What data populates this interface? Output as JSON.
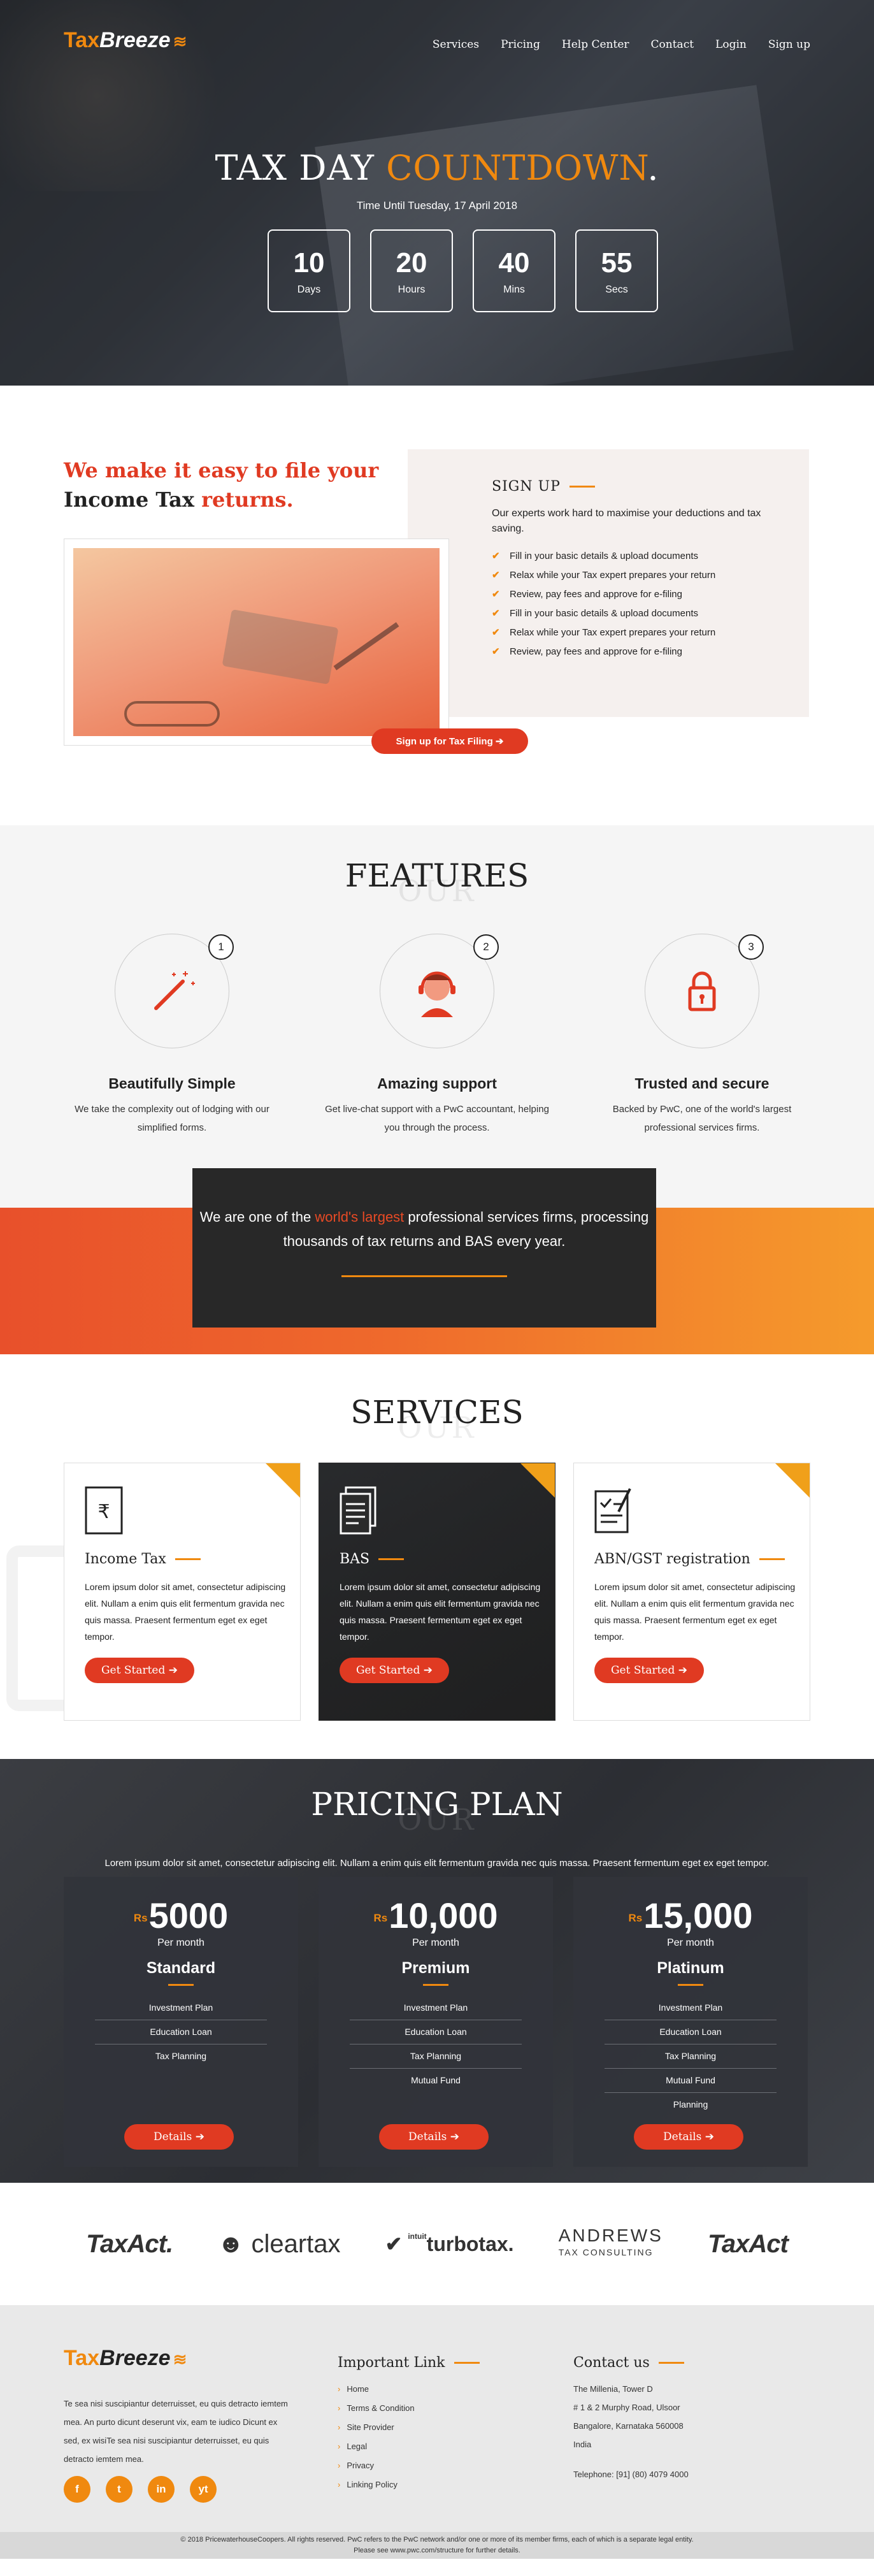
{
  "brand": {
    "tax": "Tax",
    "breeze": "Breeze",
    "swirl_icon": "wind-swirl-icon"
  },
  "nav": [
    "Services",
    "Pricing",
    "Help Center",
    "Contact",
    "Login",
    "Sign up"
  ],
  "hero": {
    "title_plain": "TAX DAY",
    "title_accent": "COUNTDOWN",
    "title_dot": ".",
    "subtitle": "Time Until Tuesday, 17 April 2018",
    "countdown": [
      {
        "value": "10",
        "unit": "Days"
      },
      {
        "value": "20",
        "unit": "Hours"
      },
      {
        "value": "40",
        "unit": "Mins"
      },
      {
        "value": "55",
        "unit": "Secs"
      }
    ]
  },
  "intro": {
    "headline_red_1": "We make it easy  to file your",
    "headline_dark": "Income Tax",
    "headline_red_2": "returns.",
    "cta": "Sign up for Tax Filing",
    "signup": {
      "title": "SIGN UP",
      "text": "Our experts work hard to maximise your deductions and tax saving.",
      "items": [
        "Fill in your basic details & upload documents",
        "Relax while your Tax expert prepares your return",
        "Review, pay fees and approve for e-filing",
        "Fill in your basic details & upload documents",
        "Relax while your Tax expert prepares your return",
        "Review, pay fees and approve for e-filing"
      ]
    }
  },
  "features": {
    "ghost": "OUR",
    "title": "FEATURES",
    "items": [
      {
        "num": "1",
        "icon": "magic-wand-icon",
        "title": "Beautifully Simple",
        "text": "We take the complexity out of lodging with our simplified forms."
      },
      {
        "num": "2",
        "icon": "support-agent-icon",
        "title": "Amazing support",
        "text": "Get live-chat support with a PwC accountant, helping you through the process."
      },
      {
        "num": "3",
        "icon": "padlock-icon",
        "title": "Trusted and secure",
        "text": "Backed by PwC, one of the world's largest professional services firms."
      }
    ]
  },
  "banner": {
    "pre": "We are one of the",
    "accent": "world's largest",
    "post": "professional services firms, processing thousands of tax returns and BAS every year."
  },
  "services": {
    "ghost": "OUR",
    "title": "SERVICES",
    "items": [
      {
        "icon": "rupee-document-icon",
        "title": "Income Tax",
        "text": "Lorem ipsum dolor sit amet, consectetur adipiscing elit. Nullam a enim quis elit fermentum gravida nec quis massa. Praesent fermentum eget ex eget tempor.",
        "button": "Get Started"
      },
      {
        "icon": "documents-icon",
        "title": "BAS",
        "text": "Lorem ipsum dolor sit amet, consectetur adipiscing elit. Nullam a enim quis elit fermentum gravida nec quis massa. Praesent fermentum eget ex eget tempor.",
        "button": "Get Started"
      },
      {
        "icon": "checklist-icon",
        "title": "ABN/GST registration",
        "text": "Lorem ipsum dolor sit amet, consectetur adipiscing elit. Nullam a enim quis elit fermentum gravida nec quis massa. Praesent fermentum eget ex eget tempor.",
        "button": "Get Started"
      }
    ]
  },
  "pricing": {
    "ghost": "OUR",
    "title": "PRICING PLAN",
    "desc": "Lorem ipsum dolor sit amet, consectetur adipiscing elit. Nullam a enim quis elit fermentum gravida nec quis massa. Praesent fermentum eget ex eget tempor.",
    "plans": [
      {
        "currency": "Rs",
        "price": "5000",
        "per": "Per month",
        "name": "Standard",
        "features": [
          "Investment Plan",
          "Education Loan",
          "Tax Planning"
        ],
        "button": "Details"
      },
      {
        "currency": "Rs",
        "price": "10,000",
        "per": "Per month",
        "name": "Premium",
        "features": [
          "Investment Plan",
          "Education Loan",
          "Tax Planning",
          "Mutual Fund"
        ],
        "button": "Details"
      },
      {
        "currency": "Rs",
        "price": "15,000",
        "per": "Per month",
        "name": "Platinum",
        "features": [
          "Investment Plan",
          "Education Loan",
          "Tax Planning",
          "Mutual Fund",
          "Planning"
        ],
        "button": "Details"
      }
    ]
  },
  "partners": [
    "TaxAct.",
    "cleartax",
    "turbotax.",
    "ANDREWS",
    "TAX CONSULTING",
    "TaxAct"
  ],
  "partner_intuit": "intuit",
  "footer": {
    "about": "Te sea nisi suscipiantur deterruisset, eu quis detracto iemtem mea. An purto dicunt deserunt vix, eam te iudico Dicunt ex sed, ex wisiTe sea nisi suscipiantur deterruisset, eu quis detracto iemtem mea.",
    "socials": [
      "f",
      "t",
      "in",
      "yt"
    ],
    "links_title": "Important Link",
    "links": [
      "Home",
      "Terms & Condition",
      "Site Provider",
      "Legal",
      "Privacy",
      "Linking Policy"
    ],
    "contact_title": "Contact us",
    "contact_lines": [
      "The Millenia, Tower D",
      "# 1 & 2 Murphy Road, Ulsoor",
      "Bangalore, Karnataka 560008",
      "India"
    ],
    "phone": "Telephone: [91] (80) 4079 4000",
    "copyright_1": "© 2018 PricewaterhouseCoopers. All rights reserved. PwC refers to the PwC network and/or one or more of its member firms, each of which is a separate legal entity.",
    "copyright_2": "Please see www.pwc.com/structure for further details."
  }
}
